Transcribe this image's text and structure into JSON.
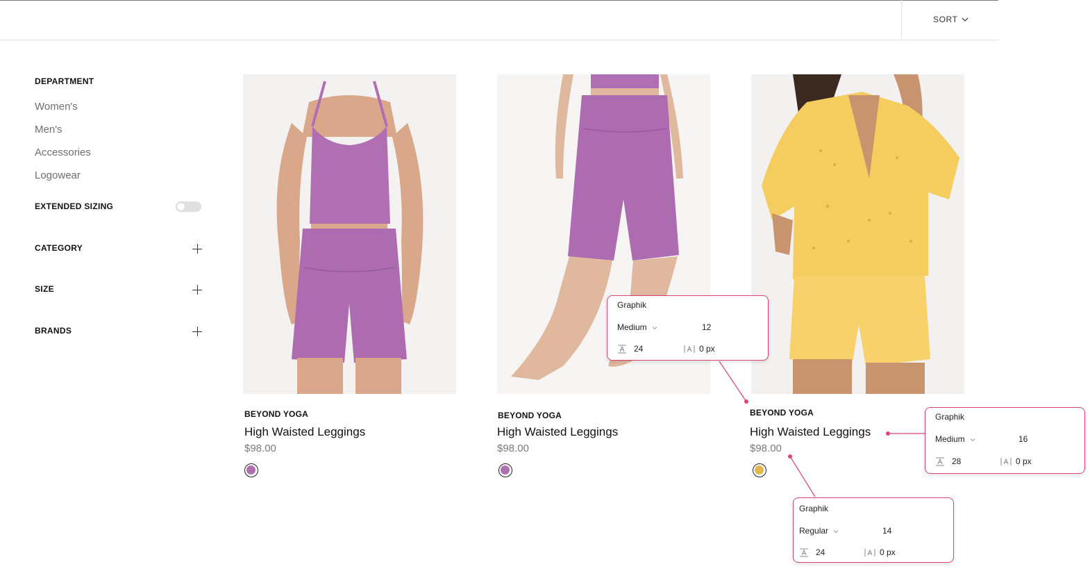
{
  "toolbar": {
    "sort_label": "SORT"
  },
  "sidebar": {
    "department_title": "DEPARTMENT",
    "departments": [
      "Women's",
      "Men's",
      "Accessories",
      "Logowear"
    ],
    "extended_sizing_label": "EXTENDED SIZING",
    "extended_sizing_on": false,
    "category_title": "CATEGORY",
    "size_title": "SIZE",
    "brands_title": "BRANDS"
  },
  "products": [
    {
      "brand": "BEYOND YOGA",
      "name": "High Waisted Leggings",
      "price": "$98.00",
      "swatch_color": "#b06fb3"
    },
    {
      "brand": "BEYOND YOGA",
      "name": "High Waisted Leggings",
      "price": "$98.00",
      "swatch_color": "#b06fb3"
    },
    {
      "brand": "BEYOND YOGA",
      "name": "High Waisted Leggings",
      "price": "$98.00",
      "swatch_color": "#e3b84a"
    }
  ],
  "annotations": [
    {
      "font": "Graphik",
      "weight": "Medium",
      "size": "12",
      "line_height": "24",
      "letter_spacing": "0 px"
    },
    {
      "font": "Graphik",
      "weight": "Medium",
      "size": "16",
      "line_height": "28",
      "letter_spacing": "0 px"
    },
    {
      "font": "Graphik",
      "weight": "Regular",
      "size": "14",
      "line_height": "24",
      "letter_spacing": "0 px"
    }
  ],
  "colors": {
    "accent": "#e0427a",
    "muted_text": "#6e6e6e"
  }
}
